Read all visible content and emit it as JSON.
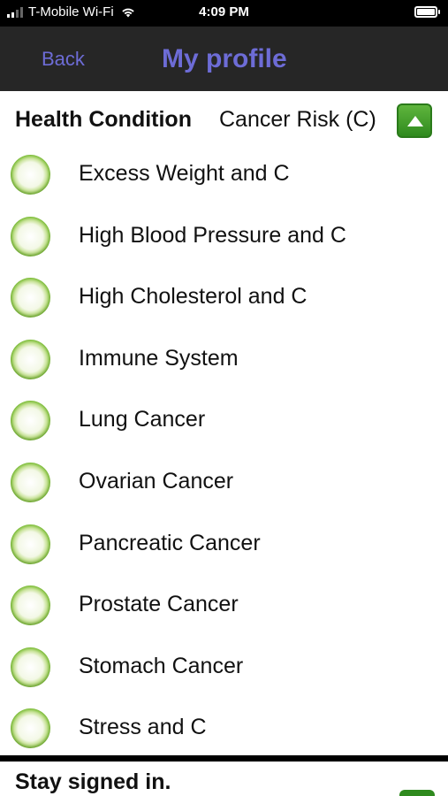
{
  "status_bar": {
    "carrier": "T-Mobile Wi-Fi",
    "time": "4:09 PM",
    "icons": [
      "signal-icon",
      "wifi-icon",
      "battery-icon"
    ]
  },
  "nav": {
    "back_label": "Back",
    "title": "My profile",
    "title_color": "#6d6cd6"
  },
  "section": {
    "label": "Health Condition",
    "value": "Cancer Risk (C)",
    "toggle_icon": "chevron-up-icon"
  },
  "conditions": [
    {
      "label": "Excess Weight and C"
    },
    {
      "label": "High Blood Pressure and C"
    },
    {
      "label": "High Cholesterol and C"
    },
    {
      "label": "Immune System"
    },
    {
      "label": "Lung Cancer"
    },
    {
      "label": "Ovarian Cancer"
    },
    {
      "label": "Pancreatic Cancer"
    },
    {
      "label": "Prostate Cancer"
    },
    {
      "label": "Stomach Cancer"
    },
    {
      "label": "Stress and C"
    }
  ],
  "footer": {
    "stay_signed_label": "Stay signed in."
  },
  "colors": {
    "accent": "#6d6cd6",
    "green": "#4a9419",
    "nav_bg": "#262626"
  }
}
